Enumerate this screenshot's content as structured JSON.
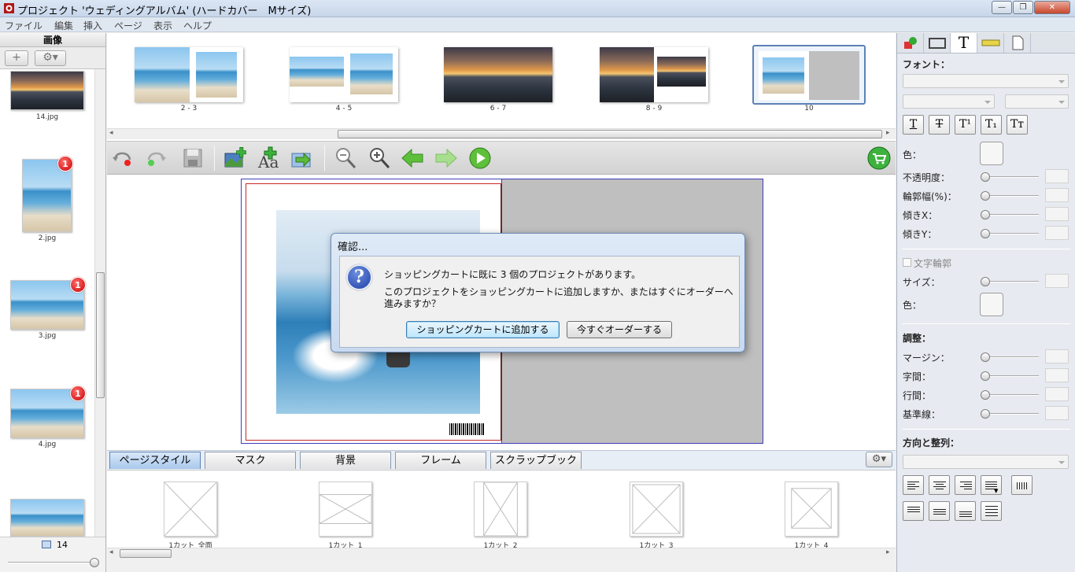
{
  "window": {
    "title": "プロジェクト 'ウェディングアルバム' (ハードカバー　Mサイズ)"
  },
  "menu": [
    "ファイル",
    "編集",
    "挿入",
    "ページ",
    "表示",
    "ヘルプ"
  ],
  "left_panel": {
    "header": "画像",
    "add_label": "+",
    "images": [
      {
        "name": "14.jpg",
        "badge": ""
      },
      {
        "name": "2.jpg",
        "badge": "1"
      },
      {
        "name": "3.jpg",
        "badge": "1"
      },
      {
        "name": "4.jpg",
        "badge": "1"
      }
    ],
    "count": "14"
  },
  "spreads": [
    {
      "label": "2 - 3"
    },
    {
      "label": "4 - 5"
    },
    {
      "label": "6 - 7"
    },
    {
      "label": "8 - 9"
    },
    {
      "label": "10"
    }
  ],
  "dialog": {
    "title": "確認...",
    "line1": "ショッピングカートに既に 3 個のプロジェクトがあります。",
    "line2": "このプロジェクトをショッピングカートに追加しますか、またはすぐにオーダーへ",
    "line3": "進みますか？",
    "add_button": "ショッピングカートに追加する",
    "order_button": "今すぐオーダーする"
  },
  "tabs": [
    "ページスタイル",
    "マスク",
    "背景",
    "フレーム",
    "スクラップブック"
  ],
  "page_styles": [
    "1カット_全面",
    "1カット_1",
    "1カット_2",
    "1カット_3",
    "1カット_4"
  ],
  "right_panel": {
    "font_label": "フォント：",
    "format_buttons": [
      "T",
      "T",
      "T¹",
      "T₁",
      "Tт"
    ],
    "color_label": "色：",
    "opacity_label": "不透明度：",
    "outline_width_label": "輪郭幅(%)：",
    "skew_x_label": "傾きX：",
    "skew_y_label": "傾きY：",
    "text_outline_label": "文字輪郭",
    "size_label": "サイズ：",
    "color2_label": "色：",
    "adjust_label": "調整：",
    "margin_label": "マージン：",
    "char_spacing_label": "字間：",
    "line_spacing_label": "行間：",
    "baseline_label": "基準線：",
    "direction_label": "方向と整列："
  },
  "colors": {
    "accent": "#3e3eb8",
    "badge": "#c80000",
    "selected_spread": "#5d82b6"
  }
}
